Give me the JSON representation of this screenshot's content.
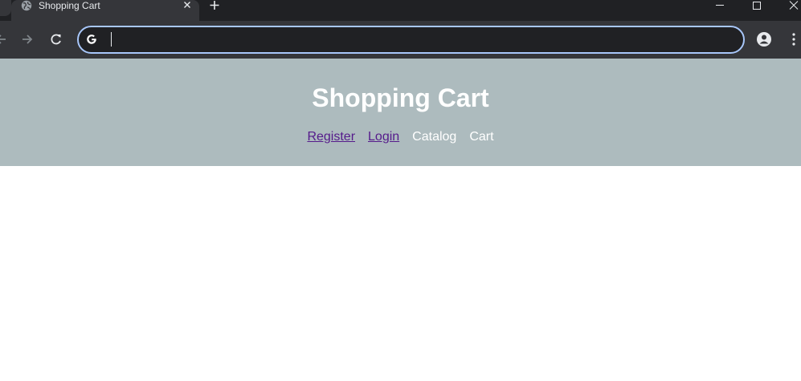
{
  "browser": {
    "tab": {
      "title": "Shopping Cart"
    },
    "address_bar": {
      "value": "",
      "placeholder": ""
    }
  },
  "site": {
    "title": "Shopping Cart",
    "nav": {
      "register": "Register",
      "login": "Login",
      "catalog": "Catalog",
      "cart": "Cart"
    }
  },
  "colors": {
    "header_bg": "#adbbbe",
    "visited_link": "#551a8b",
    "omnibox_focus": "#a8c7fa",
    "chrome_dark": "#202124",
    "chrome_toolbar": "#35363a"
  }
}
